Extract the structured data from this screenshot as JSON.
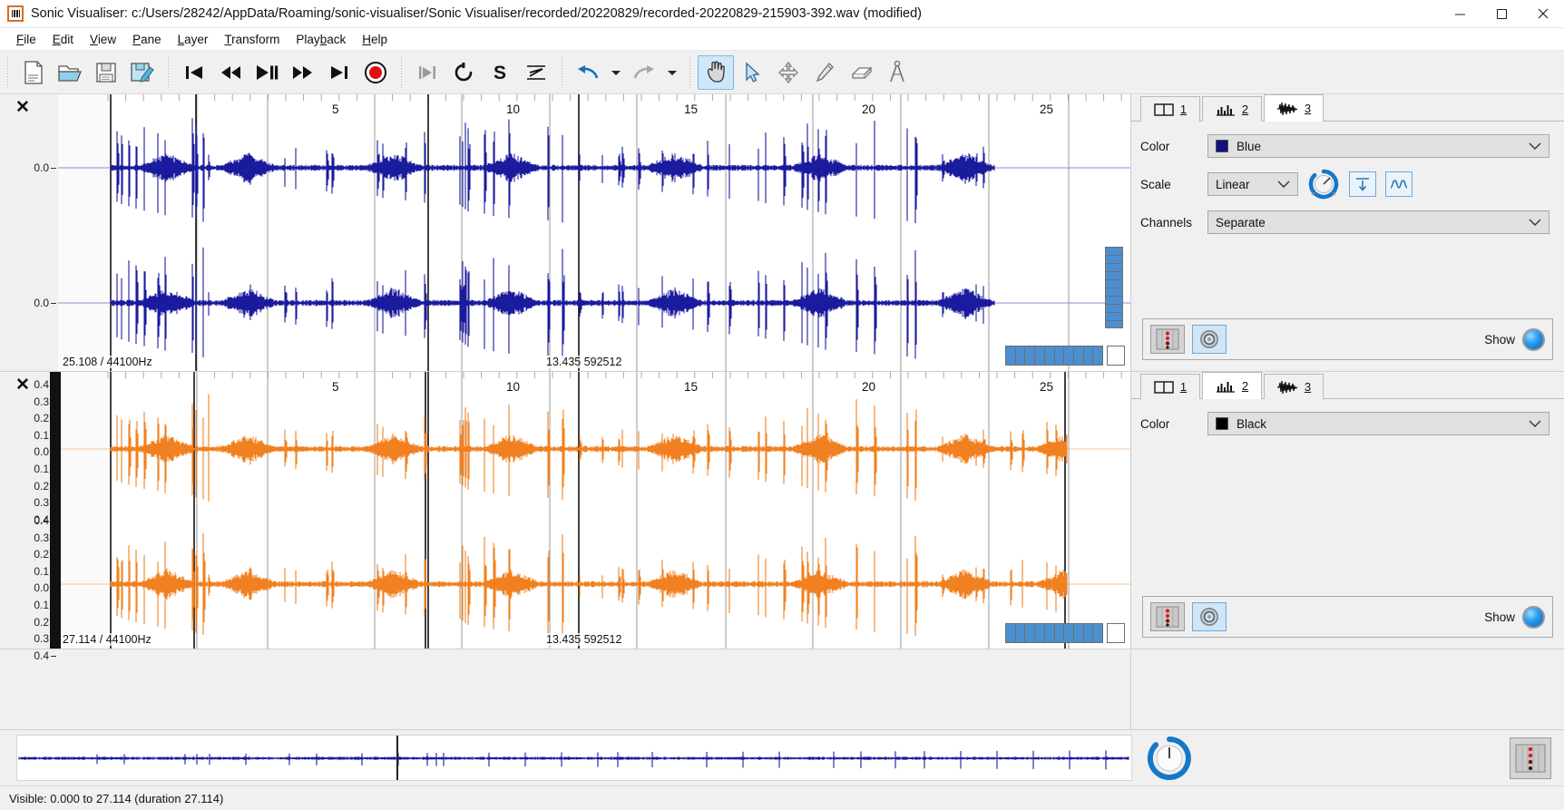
{
  "window": {
    "app_name": "Sonic Visualiser",
    "title": "Sonic Visualiser: c:/Users/28242/AppData/Roaming/sonic-visualiser/Sonic Visualiser/recorded/20220829/recorded-20220829-215903-392.wav (modified)",
    "minimize": "─",
    "maximize": "☐",
    "close": "✕"
  },
  "menubar": {
    "items": [
      {
        "label": "File",
        "mnemonic": "F"
      },
      {
        "label": "Edit",
        "mnemonic": "E"
      },
      {
        "label": "View",
        "mnemonic": "V"
      },
      {
        "label": "Pane",
        "mnemonic": "P"
      },
      {
        "label": "Layer",
        "mnemonic": "L"
      },
      {
        "label": "Transform",
        "mnemonic": "T"
      },
      {
        "label": "Playback",
        "mnemonic": "b"
      },
      {
        "label": "Help",
        "mnemonic": "H"
      }
    ]
  },
  "toolbar": {
    "buttons": [
      {
        "name": "new-session-button",
        "icon": "new-document-icon",
        "active": false
      },
      {
        "name": "open-session-button",
        "icon": "open-folder-icon",
        "active": false
      },
      {
        "name": "save-session-button",
        "icon": "save-disk-icon",
        "active": false
      },
      {
        "name": "save-session-as-button",
        "icon": "save-as-disk-pencil-icon",
        "active": false
      },
      {
        "name": "rewind-to-start-button",
        "icon": "skip-to-start-icon",
        "active": false
      },
      {
        "name": "rewind-button",
        "icon": "rewind-icon",
        "active": false
      },
      {
        "name": "play-pause-button",
        "icon": "play-pause-icon",
        "active": false
      },
      {
        "name": "fast-forward-button",
        "icon": "fast-forward-icon",
        "active": false
      },
      {
        "name": "fast-forward-to-end-button",
        "icon": "skip-to-end-icon",
        "active": false
      },
      {
        "name": "record-button",
        "icon": "record-icon",
        "active": false
      },
      {
        "name": "play-selection-button",
        "icon": "play-selection-icon",
        "active": false
      },
      {
        "name": "loop-playback-button",
        "icon": "loop-icon",
        "active": false
      },
      {
        "name": "solo-button",
        "icon": "solo-s-icon",
        "active": false
      },
      {
        "name": "align-button",
        "icon": "align-icon",
        "active": false
      },
      {
        "name": "undo-button",
        "icon": "undo-arrow-icon",
        "active": false
      },
      {
        "name": "undo-menu-button",
        "icon": "chevron-down-icon",
        "active": false
      },
      {
        "name": "redo-button",
        "icon": "redo-arrow-icon",
        "active": false
      },
      {
        "name": "redo-menu-button",
        "icon": "chevron-down-icon",
        "active": false
      },
      {
        "name": "navigate-tool-button",
        "icon": "hand-icon",
        "active": true
      },
      {
        "name": "select-tool-button",
        "icon": "cursor-arrow-icon",
        "active": false
      },
      {
        "name": "edit-tool-button",
        "icon": "move-cross-icon",
        "active": false
      },
      {
        "name": "draw-tool-button",
        "icon": "pencil-icon",
        "active": false
      },
      {
        "name": "erase-tool-button",
        "icon": "eraser-icon",
        "active": false
      },
      {
        "name": "measure-tool-button",
        "icon": "calipers-icon",
        "active": false
      }
    ]
  },
  "panes": [
    {
      "id": "pane-1",
      "layer_color": "#1b1b9e",
      "zero_line_color": "#8a8ad0",
      "time_ticks": [
        {
          "label": "5",
          "x": 310
        },
        {
          "label": "10",
          "x": 506
        },
        {
          "label": "15",
          "x": 702
        },
        {
          "label": "20",
          "x": 898
        },
        {
          "label": "25",
          "x": 1094
        }
      ],
      "y_ticks": [
        "0.0",
        "0.0"
      ],
      "footer_left": "25.108 / 44100Hz",
      "footer_center": "13.435  592512",
      "close_label": "✕"
    },
    {
      "id": "pane-2",
      "layer_color": "#f08020",
      "zero_line_color": "#f3c79a",
      "time_ticks": [
        {
          "label": "5",
          "x": 310
        },
        {
          "label": "10",
          "x": 506
        },
        {
          "label": "15",
          "x": 702
        },
        {
          "label": "20",
          "x": 898
        },
        {
          "label": "25",
          "x": 1094
        }
      ],
      "y_ticks": [
        "0.4",
        "0.3",
        "0.2",
        "0.1",
        "0.0",
        "0.1",
        "0.2",
        "0.3",
        "0.4",
        "0.4",
        "0.3",
        "0.2",
        "0.1",
        "0.0",
        "0.1",
        "0.2",
        "0.3",
        "0.4"
      ],
      "footer_left": "27.114 / 44100Hz",
      "footer_center": "13.435  592512",
      "close_label": "✕"
    }
  ],
  "property_panels": [
    {
      "id": "property-panel-1",
      "tabs": [
        {
          "label": "1",
          "icon": "pane-split-icon",
          "selected": false
        },
        {
          "label": "2",
          "icon": "histogram-icon",
          "selected": false
        },
        {
          "label": "3",
          "icon": "waveform-icon",
          "selected": true
        }
      ],
      "rows": [
        {
          "label": "Color",
          "type": "color-combo",
          "value": "Blue",
          "swatch": "#10107e"
        },
        {
          "label": "Scale",
          "type": "scale-combo",
          "value": "Linear"
        },
        {
          "label": "Channels",
          "type": "combo",
          "value": "Separate"
        }
      ],
      "gain_knob": true,
      "normalize_button": "normalize-icon",
      "curve_button": "waveform-shape-icon",
      "footer": {
        "meter_icon": "level-meter-icon",
        "play_icon": "play-speaker-icon",
        "show_label": "Show",
        "led_on": true
      }
    },
    {
      "id": "property-panel-2",
      "tabs": [
        {
          "label": "1",
          "icon": "pane-split-icon",
          "selected": false
        },
        {
          "label": "2",
          "icon": "histogram-icon",
          "selected": true
        },
        {
          "label": "3",
          "icon": "waveform-icon",
          "selected": false
        }
      ],
      "rows": [
        {
          "label": "Color",
          "type": "color-combo",
          "value": "Black",
          "swatch": "#000000"
        }
      ],
      "gain_knob": false,
      "footer": {
        "meter_icon": "level-meter-icon",
        "play_icon": "play-speaker-icon",
        "show_label": "Show",
        "led_on": true
      }
    }
  ],
  "overview": {
    "wave_color": "#1b1b9e",
    "playhead_x": 435
  },
  "statusbar": {
    "text": "Visible: 0.000 to 27.114 (duration 27.114)"
  },
  "colors": {
    "accent_blue": "#2a9cf0",
    "selected_tab_bg": "#cde8fa",
    "waveform_blue": "#1b1b9e",
    "waveform_orange": "#f08020"
  }
}
